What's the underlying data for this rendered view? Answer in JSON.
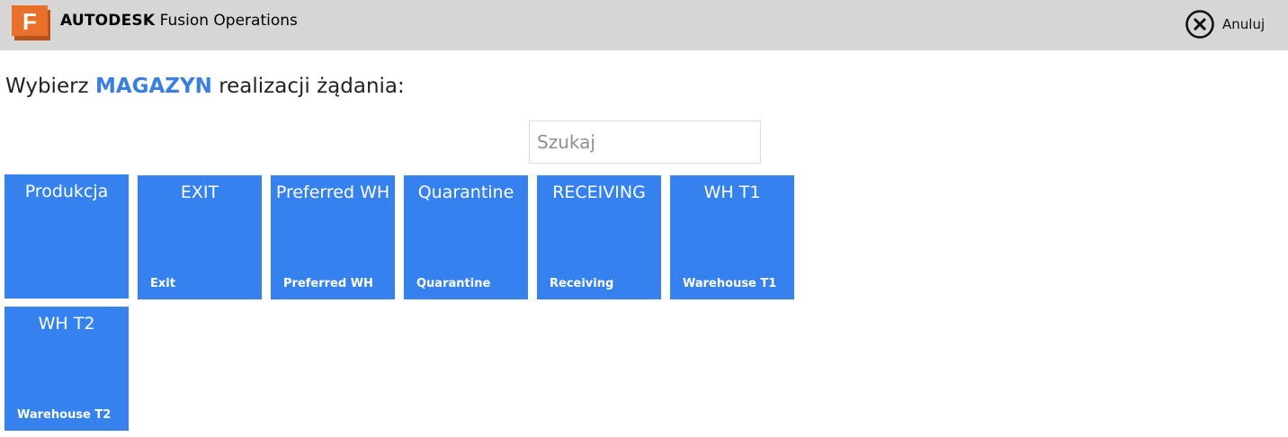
{
  "header": {
    "brand_bold": "AUTODESK",
    "brand_rest": "Fusion Operations",
    "logo_letter": "F",
    "cancel_label": "Anuluj"
  },
  "prompt": {
    "prefix": "Wybierz",
    "highlight": "MAGAZYN",
    "suffix": "realizacji żądania:"
  },
  "search": {
    "placeholder": "Szukaj",
    "value": ""
  },
  "tiles": [
    {
      "title": "Produkcja",
      "subtitle": ""
    },
    {
      "title": "EXIT",
      "subtitle": "Exit"
    },
    {
      "title": "Preferred WH",
      "subtitle": "Preferred WH"
    },
    {
      "title": "Quarantine",
      "subtitle": "Quarantine"
    },
    {
      "title": "RECEIVING",
      "subtitle": "Receiving"
    },
    {
      "title": "WH T1",
      "subtitle": "Warehouse T1"
    },
    {
      "title": "WH T2",
      "subtitle": "Warehouse T2"
    }
  ],
  "colors": {
    "tile": "#3582ee",
    "highlight": "#3a7fde",
    "header": "#d6d6d6",
    "logo": "#e8702a"
  }
}
